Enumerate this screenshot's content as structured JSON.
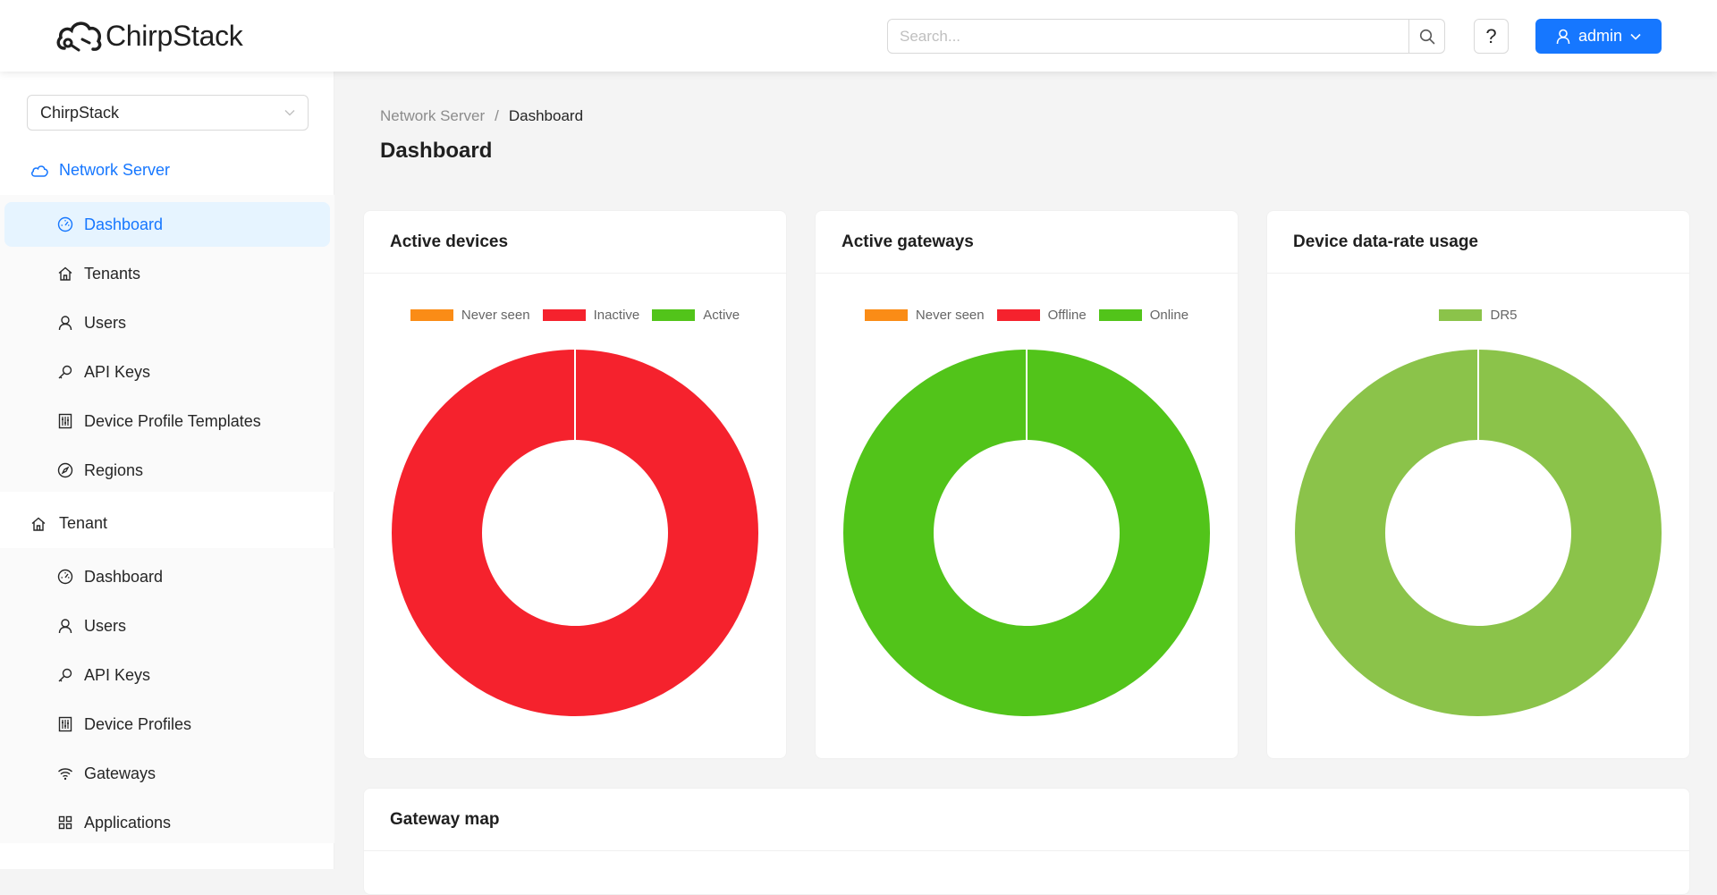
{
  "app": {
    "name": "ChirpStack"
  },
  "header": {
    "search_placeholder": "Search...",
    "help_label": "?",
    "user_label": "admin"
  },
  "sidebar": {
    "tenant_select_value": "ChirpStack",
    "network_server": {
      "label": "Network Server",
      "items": [
        {
          "label": "Dashboard",
          "icon": "dashboard-icon"
        },
        {
          "label": "Tenants",
          "icon": "home-icon"
        },
        {
          "label": "Users",
          "icon": "user-icon"
        },
        {
          "label": "API Keys",
          "icon": "key-icon"
        },
        {
          "label": "Device Profile Templates",
          "icon": "sliders-icon"
        },
        {
          "label": "Regions",
          "icon": "compass-icon"
        }
      ]
    },
    "tenant": {
      "label": "Tenant",
      "items": [
        {
          "label": "Dashboard",
          "icon": "dashboard-icon"
        },
        {
          "label": "Users",
          "icon": "user-icon"
        },
        {
          "label": "API Keys",
          "icon": "key-icon"
        },
        {
          "label": "Device Profiles",
          "icon": "sliders-icon"
        },
        {
          "label": "Gateways",
          "icon": "wifi-icon"
        },
        {
          "label": "Applications",
          "icon": "apps-icon"
        }
      ]
    }
  },
  "breadcrumb": {
    "parent": "Network Server",
    "separator": "/",
    "current": "Dashboard"
  },
  "page": {
    "title": "Dashboard"
  },
  "colors": {
    "accent": "#1677ff",
    "never_seen": "#fa8c16",
    "inactive": "#f5222d",
    "active": "#52c41a",
    "dr5": "#8bc34a"
  },
  "chart_data": [
    {
      "type": "pie",
      "title": "Active devices",
      "categories": [
        "Never seen",
        "Inactive",
        "Active"
      ],
      "values": [
        0,
        1,
        0
      ],
      "colors": [
        "#fa8c16",
        "#f5222d",
        "#52c41a"
      ]
    },
    {
      "type": "pie",
      "title": "Active gateways",
      "categories": [
        "Never seen",
        "Offline",
        "Online"
      ],
      "values": [
        0,
        0,
        1
      ],
      "colors": [
        "#fa8c16",
        "#f5222d",
        "#52c41a"
      ]
    },
    {
      "type": "pie",
      "title": "Device data-rate usage",
      "categories": [
        "DR5"
      ],
      "values": [
        1
      ],
      "colors": [
        "#8bc34a"
      ]
    }
  ],
  "gateway_map": {
    "title": "Gateway map"
  }
}
